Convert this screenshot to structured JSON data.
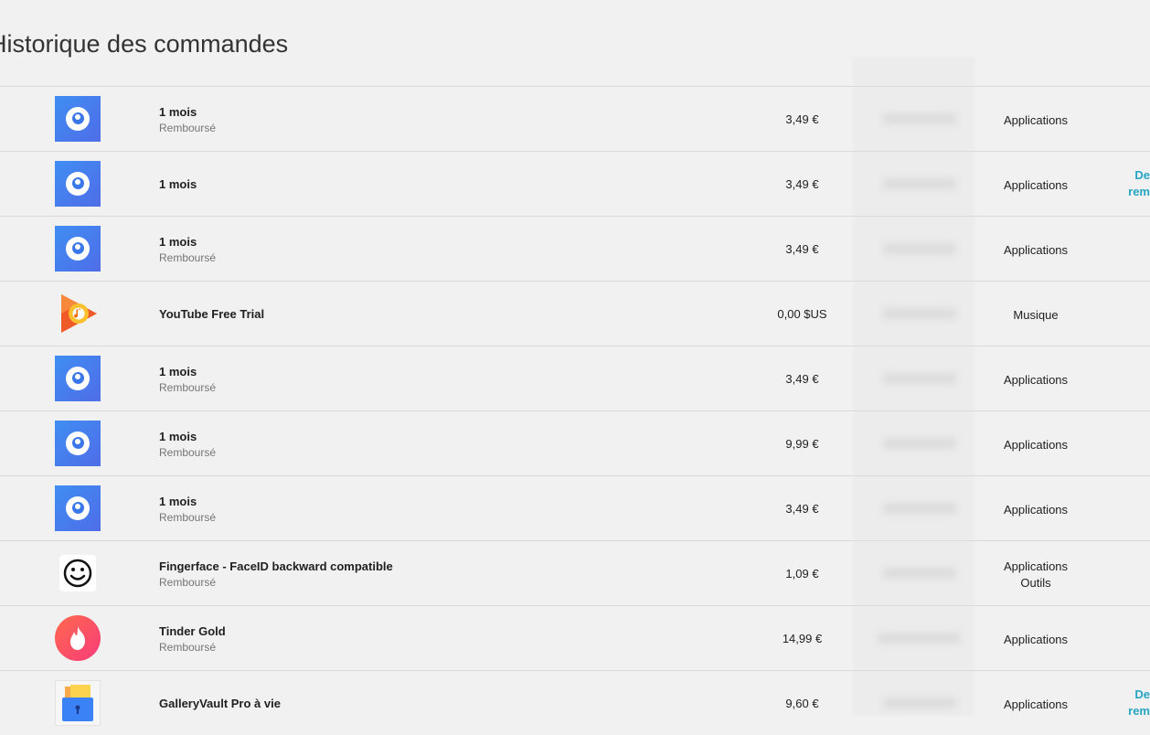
{
  "page": {
    "title": "Historique des commandes"
  },
  "orders": [
    {
      "name": "1 mois",
      "status": "Remboursé",
      "price": "3,49 €",
      "category": "Applications",
      "category2": "",
      "action1": "",
      "action2": ""
    },
    {
      "name": "1 mois",
      "status": "",
      "price": "3,49 €",
      "category": "Applications",
      "category2": "",
      "action1": "De",
      "action2": "rem"
    },
    {
      "name": "1 mois",
      "status": "Remboursé",
      "price": "3,49 €",
      "category": "Applications",
      "category2": "",
      "action1": "",
      "action2": ""
    },
    {
      "name": "YouTube Free Trial",
      "status": "",
      "price": "0,00 $US",
      "category": "Musique",
      "category2": "",
      "action1": "",
      "action2": ""
    },
    {
      "name": "1 mois",
      "status": "Remboursé",
      "price": "3,49 €",
      "category": "Applications",
      "category2": "",
      "action1": "",
      "action2": ""
    },
    {
      "name": "1 mois",
      "status": "Remboursé",
      "price": "9,99 €",
      "category": "Applications",
      "category2": "",
      "action1": "",
      "action2": ""
    },
    {
      "name": "1 mois",
      "status": "Remboursé",
      "price": "3,49 €",
      "category": "Applications",
      "category2": "",
      "action1": "",
      "action2": ""
    },
    {
      "name": "Fingerface - FaceID backward compatible",
      "status": "Remboursé",
      "price": "1,09 €",
      "category": "Applications",
      "category2": "Outils",
      "action1": "",
      "action2": ""
    },
    {
      "name": "Tinder Gold",
      "status": "Remboursé",
      "price": "14,99 €",
      "category": "Applications",
      "category2": "",
      "action1": "",
      "action2": ""
    },
    {
      "name": "GalleryVault Pro à vie",
      "status": "",
      "price": "9,60 €",
      "category": "Applications",
      "category2": "",
      "action1": "De",
      "action2": "rem"
    }
  ],
  "icons": [
    "app-blue-icon",
    "app-blue-icon",
    "app-blue-icon",
    "play-music-icon",
    "app-blue-icon",
    "app-blue-icon",
    "app-blue-icon",
    "smiley-face-icon",
    "tinder-flame-icon",
    "gallery-vault-icon"
  ],
  "colors": {
    "accent": "#26a5c3",
    "background": "#f1f1f1",
    "divider": "#dadada"
  }
}
